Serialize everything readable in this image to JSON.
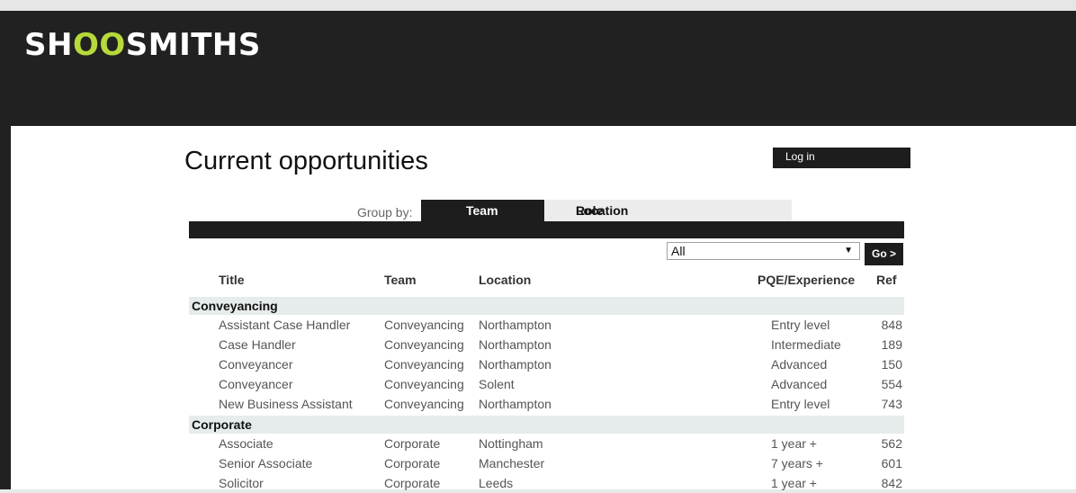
{
  "brand": {
    "logo_pre": "SH",
    "logo_rings": "OO",
    "logo_post": "SMITHS"
  },
  "page": {
    "title": "Current opportunities"
  },
  "login": {
    "label": "Log in"
  },
  "groupby": {
    "label": "Group by:",
    "tabs": [
      "Team",
      "Location",
      "Role"
    ],
    "active": "Team"
  },
  "filter": {
    "selected": "All",
    "arrow": "▼",
    "go_label": "Go >"
  },
  "columns": {
    "title": "Title",
    "team": "Team",
    "location": "Location",
    "pqe": "PQE/Experience",
    "ref": "Ref"
  },
  "groups": [
    {
      "name": "Conveyancing",
      "rows": [
        {
          "title": "Assistant Case Handler",
          "team": "Conveyancing",
          "location": "Northampton",
          "pqe": "Entry level",
          "ref": "848"
        },
        {
          "title": "Case Handler",
          "team": "Conveyancing",
          "location": "Northampton",
          "pqe": "Intermediate",
          "ref": "189"
        },
        {
          "title": "Conveyancer",
          "team": "Conveyancing",
          "location": "Northampton",
          "pqe": "Advanced",
          "ref": "150"
        },
        {
          "title": "Conveyancer",
          "team": "Conveyancing",
          "location": "Solent",
          "pqe": "Advanced",
          "ref": "554"
        },
        {
          "title": "New Business Assistant",
          "team": "Conveyancing",
          "location": "Northampton",
          "pqe": "Entry level",
          "ref": "743"
        }
      ]
    },
    {
      "name": "Corporate",
      "rows": [
        {
          "title": "Associate",
          "team": "Corporate",
          "location": "Nottingham",
          "pqe": "1 year +",
          "ref": "562"
        },
        {
          "title": "Senior Associate",
          "team": "Corporate",
          "location": "Manchester",
          "pqe": "7 years +",
          "ref": "601"
        },
        {
          "title": "Solicitor",
          "team": "Corporate",
          "location": "Leeds",
          "pqe": "1 year +",
          "ref": "842"
        }
      ]
    }
  ]
}
